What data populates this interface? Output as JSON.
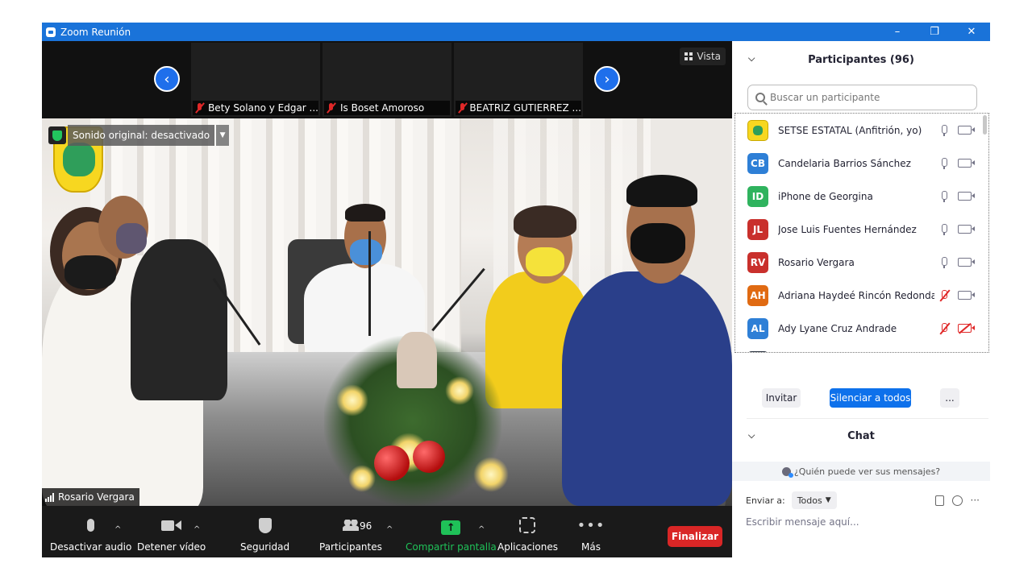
{
  "window": {
    "title": "Zoom Reunión",
    "controls": [
      "–",
      "❐",
      "✕"
    ]
  },
  "gallery": {
    "tiles": [
      {
        "label": "Bety Solano y Edgar ..."
      },
      {
        "label": "Is Boset Amoroso"
      },
      {
        "label": "BEATRIZ  GUTIERREZ ..."
      }
    ],
    "prev_arrow": "‹",
    "next_arrow": "›",
    "view_label": "Vista"
  },
  "main_video": {
    "original_sound": "Sonido original: desactivado",
    "speaker_name": "Rosario Vergara"
  },
  "toolbar": {
    "mute_label": "Desactivar audio",
    "video_label": "Detener vídeo",
    "security_label": "Seguridad",
    "participants_label": "Participantes",
    "participants_count": "96",
    "share_label": "Compartir pantalla",
    "apps_label": "Aplicaciones",
    "more_label": "Más",
    "end_label": "Finalizar",
    "caret": "^",
    "share_arrow": "↑",
    "more_dots": "•••"
  },
  "participants_panel": {
    "title": "Participantes (96)",
    "collapse_glyph": "⌵",
    "search_placeholder": "Buscar un participante",
    "participants": [
      {
        "initials": "",
        "name": "SETSE ESTATAL (Anfitrión, yo)",
        "color": "#f7d720",
        "mic_muted": false,
        "cam_off": false,
        "logo": true
      },
      {
        "initials": "CB",
        "name": "Candelaria Barrios Sánchez",
        "color": "#2e7fd6",
        "mic_muted": false,
        "cam_off": false
      },
      {
        "initials": "ID",
        "name": "iPhone de Georgina",
        "color": "#2fb35e",
        "mic_muted": false,
        "cam_off": false
      },
      {
        "initials": "JL",
        "name": "Jose Luis Fuentes Hernández",
        "color": "#c9302c",
        "mic_muted": false,
        "cam_off": false
      },
      {
        "initials": "RV",
        "name": "Rosario Vergara",
        "color": "#c9302c",
        "mic_muted": false,
        "cam_off": false
      },
      {
        "initials": "AH",
        "name": "Adriana Haydeé Rincón Redonda",
        "color": "#e06a12",
        "mic_muted": true,
        "cam_off": false
      },
      {
        "initials": "AL",
        "name": "Ady Lyane Cruz Andrade",
        "color": "#2e7fd6",
        "mic_muted": true,
        "cam_off": true
      }
    ],
    "invite_label": "Invitar",
    "mute_all_label": "Silenciar a todos",
    "more_label": "..."
  },
  "chat": {
    "title": "Chat",
    "who_can_see": "¿Quién puede ver sus mensajes?",
    "send_to_label": "Enviar a:",
    "send_to_value": "Todos",
    "more_glyph": "···",
    "input_placeholder": "Escribir mensaje aquí..."
  },
  "colors": {
    "titlebar": "#1a73d9",
    "accent_blue": "#0e71eb",
    "end_red": "#d92626",
    "share_green": "#1fc158",
    "muted_red": "#e02828"
  }
}
